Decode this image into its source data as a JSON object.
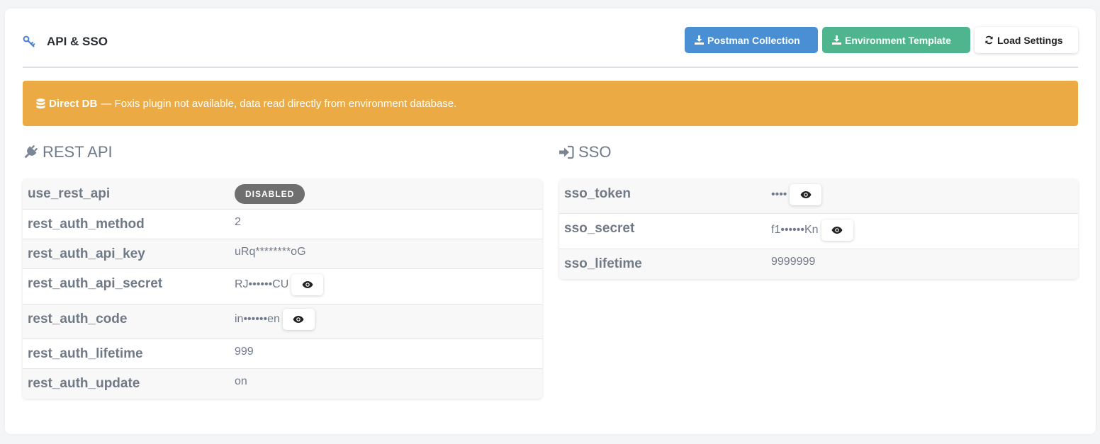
{
  "header": {
    "title": "API & SSO",
    "buttons": {
      "postman": "Postman Collection",
      "environment": "Environment Template",
      "load": "Load Settings"
    }
  },
  "alert": {
    "strong": "Direct DB",
    "message": "— Foxis plugin not available, data read directly from environment database."
  },
  "rest_api": {
    "title": "REST API",
    "rows": [
      {
        "key": "use_rest_api",
        "value": "DISABLED"
      },
      {
        "key": "rest_auth_method",
        "value": "2"
      },
      {
        "key": "rest_auth_api_key",
        "value": "uRq********oG"
      },
      {
        "key": "rest_auth_api_secret",
        "value": "RJ••••••CU"
      },
      {
        "key": "rest_auth_code",
        "value": "in••••••en"
      },
      {
        "key": "rest_auth_lifetime",
        "value": "999"
      },
      {
        "key": "rest_auth_update",
        "value": "on"
      }
    ]
  },
  "sso": {
    "title": "SSO",
    "rows": [
      {
        "key": "sso_token",
        "value": "••••"
      },
      {
        "key": "sso_secret",
        "value": "f1••••••Kn"
      },
      {
        "key": "sso_lifetime",
        "value": "9999999"
      }
    ]
  },
  "colors": {
    "accent_blue": "#4a8fd4",
    "accent_green": "#4eb58f",
    "alert_orange": "#ebaa43",
    "badge_gray": "#6f6f6f"
  },
  "icons": {
    "title": "key-icon",
    "postman": "download-icon",
    "environment": "download-icon",
    "load": "refresh-icon",
    "alert": "database-icon",
    "rest_api": "plug-icon",
    "sso": "sign-in-icon",
    "reveal": "eye-icon"
  }
}
